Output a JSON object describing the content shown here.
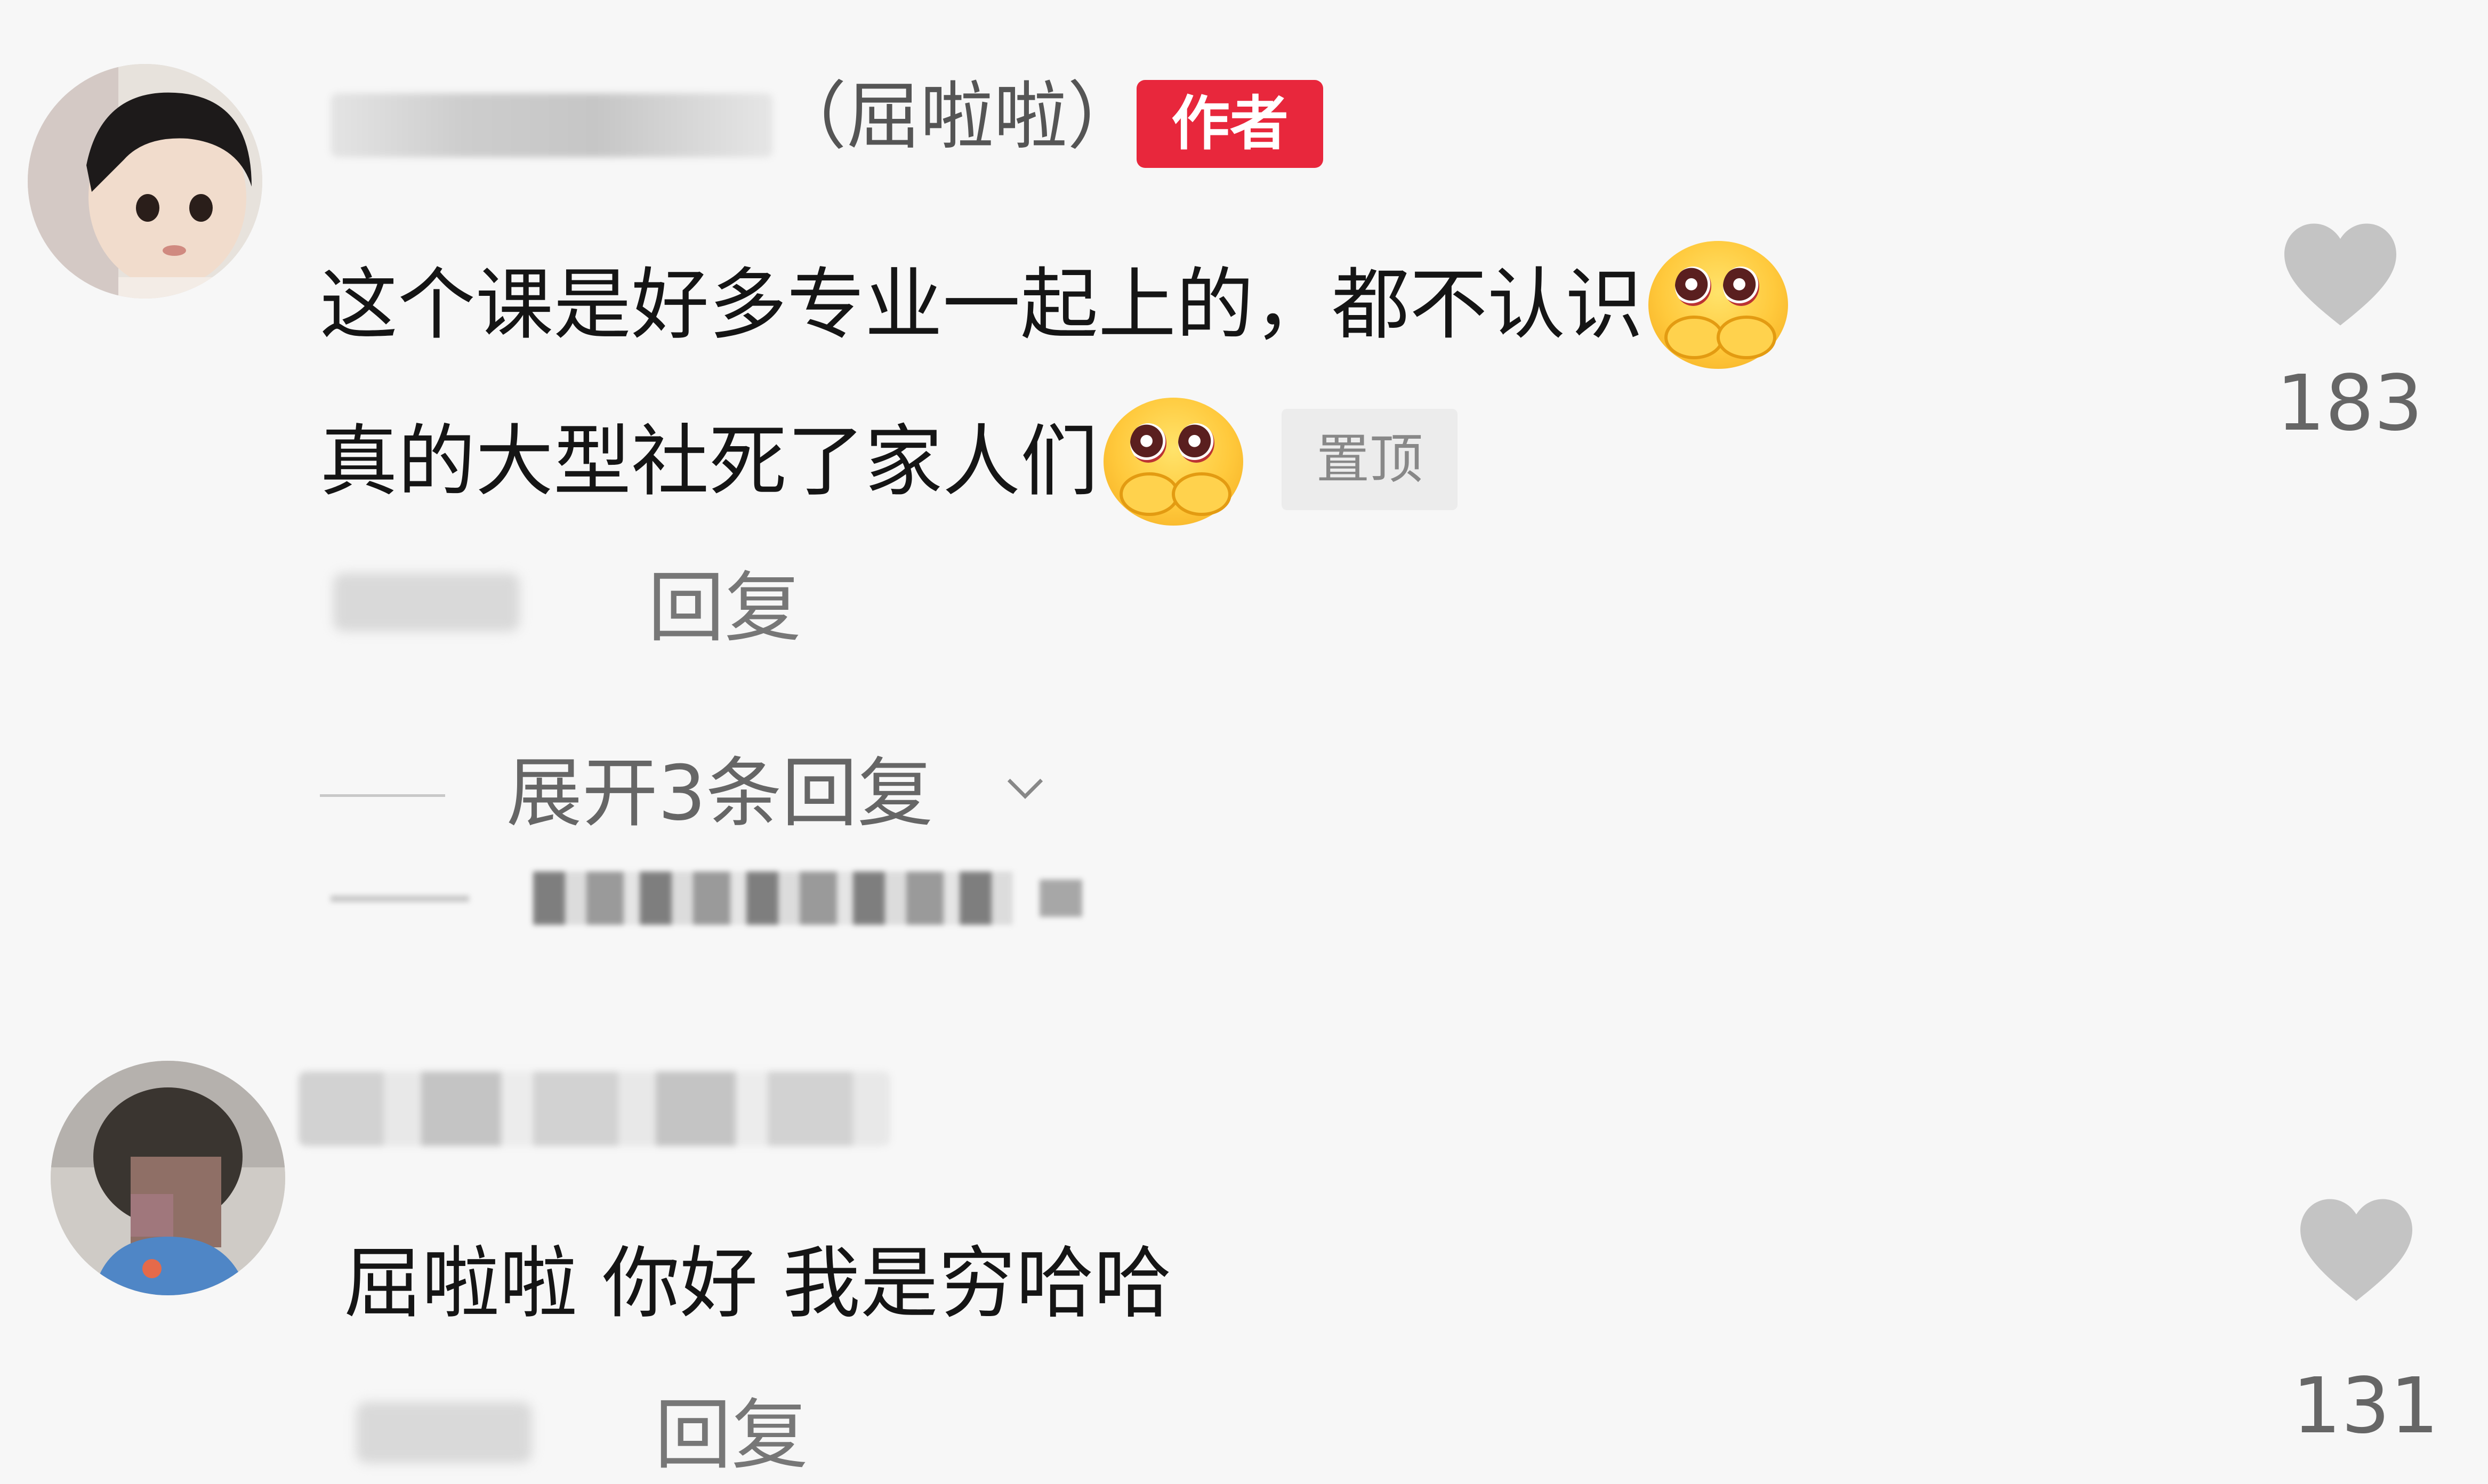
{
  "comments": [
    {
      "username_suffix": "（屈啦啦）",
      "author_badge": "作者",
      "text_line1": "这个课是好多专业一起上的，都不认识",
      "text_line2": "真的大型社死了家人们",
      "pinned_badge": "置顶",
      "like_count": "183",
      "reply_label": "回复",
      "expand_replies": "展开3条回复",
      "emoji": "pleading-face-emoji",
      "like_icon": "heart-icon",
      "expand_icon": "chevron-down-icon"
    },
    {
      "text_line1": "屈啦啦 你好 我是穷哈哈",
      "like_count": "131",
      "reply_label": "回复",
      "like_icon": "heart-icon"
    }
  ],
  "colors": {
    "background": "#f7f7f7",
    "author_badge": "#e8273c",
    "heart": "#c4c4c4",
    "secondary_text": "#777777"
  }
}
